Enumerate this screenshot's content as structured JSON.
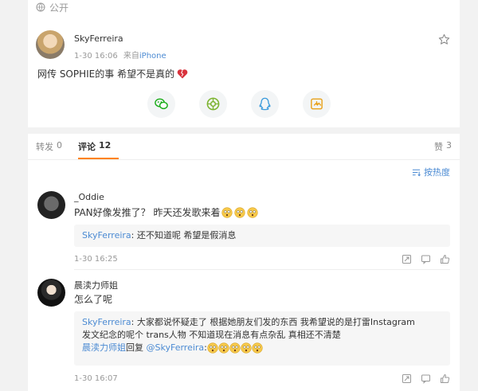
{
  "post": {
    "privacy_label": "公开",
    "author": "SkyFerreira",
    "time": "1-30 16:06",
    "source_prefix": "来自",
    "source": "iPhone",
    "text": "网传 SOPHIE的事 希望不是真的",
    "share_icons": [
      "wechat-icon",
      "moments-icon",
      "qq-icon",
      "save-image-icon"
    ]
  },
  "tabs": {
    "repost_label": "转发",
    "repost_count": "0",
    "comment_label": "评论",
    "comment_count": "12",
    "like_label": "赞",
    "like_count": "3"
  },
  "sort": {
    "label": "按热度"
  },
  "comments": [
    {
      "author": "_Oddie",
      "text": "PAN好像发推了？ 昨天还发歌来着",
      "reply": {
        "user": "SkyFerreira",
        "text": "还不知道呢 希望是假消息"
      },
      "time": "1-30 16:25"
    },
    {
      "author": "晨渎力师姐",
      "text": "怎么了呢",
      "reply": {
        "user": "SkyFerreira",
        "text_line1": "大家都说怀疑走了 根据她朋友们发的东西 我希望说的是打雷Instagram",
        "text_line2": "发文纪念的呢个 trans人物 不知道现在消息有点杂乱 真相还不清楚",
        "reply2_user": "晨渎力师姐",
        "reply2_mid": "回复",
        "reply2_target": "@SkyFerreira"
      },
      "time": "1-30 16:07"
    }
  ],
  "colors": {
    "accent": "#ff8200",
    "link": "#4c8bd3",
    "muted": "#999999",
    "background": "#f2f2f2"
  }
}
